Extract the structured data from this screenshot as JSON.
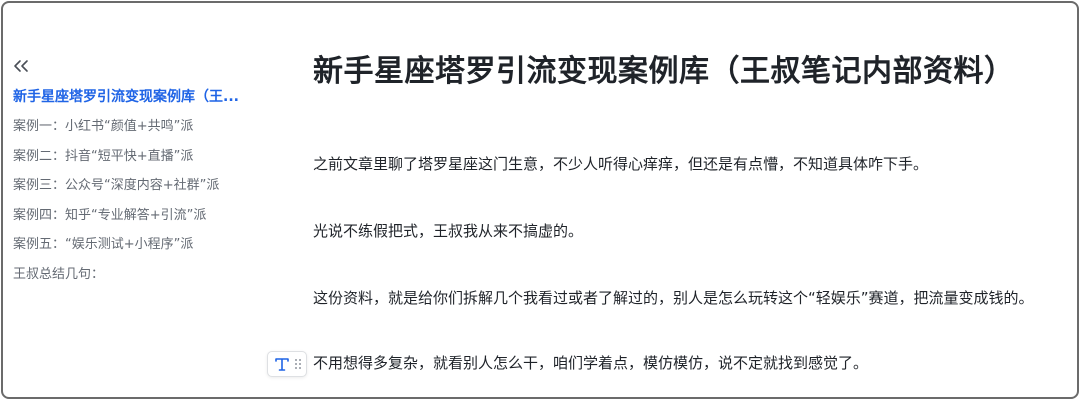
{
  "sidebar": {
    "collapse_icon": "double-chevron-left-icon",
    "items": [
      {
        "label": "新手星座塔罗引流变现案例库（王..."
      },
      {
        "label": "案例一：小红书“颜值+共鸣”派"
      },
      {
        "label": "案例二：抖音“短平快+直播”派"
      },
      {
        "label": "案例三：公众号“深度内容+社群”派"
      },
      {
        "label": "案例四：知乎“专业解答+引流”派"
      },
      {
        "label": "案例五：“娱乐测试+小程序”派"
      },
      {
        "label": "王叔总结几句："
      }
    ]
  },
  "document": {
    "title": "新手星座塔罗引流变现案例库（王叔笔记内部资料）",
    "paragraphs": [
      "之前文章里聊了塔罗星座这门生意，不少人听得心痒痒，但还是有点懵，不知道具体咋下手。",
      "光说不练假把式，王叔我从来不搞虚的。",
      "这份资料，就是给你们拆解几个我看过或者了解过的，别人是怎么玩转这个“轻娱乐”赛道，把流量变成钱的。",
      "不用想得多复杂，就看别人怎么干，咱们学着点，模仿模仿，说不定就找到感觉了。"
    ]
  },
  "block_handle": {
    "text_icon": "text-type-icon",
    "grip_icon": "drag-grip-icon"
  },
  "colors": {
    "accent": "#1f64e6",
    "text": "#1f2329",
    "muted": "#646a73",
    "border": "#6b6b6b"
  }
}
